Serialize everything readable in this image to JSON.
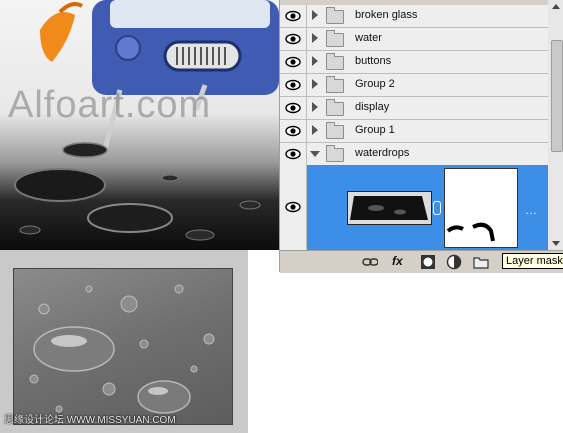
{
  "artwork": {
    "watermark_text": "Alfoart.com"
  },
  "layers_panel": {
    "layers": [
      {
        "name": "broken glass",
        "expanded": false
      },
      {
        "name": "water",
        "expanded": false
      },
      {
        "name": "buttons",
        "expanded": false
      },
      {
        "name": "Group 2",
        "expanded": false
      },
      {
        "name": "display",
        "expanded": false
      },
      {
        "name": "Group 1",
        "expanded": false
      },
      {
        "name": "waterdrops",
        "expanded": true
      }
    ],
    "mask_row_dots": "…",
    "tooltip": "Layer mask",
    "footer_icons": [
      "link-icon",
      "fx-icon",
      "mask-icon",
      "adjustment-icon",
      "folder-icon"
    ],
    "fx_label": "fx"
  },
  "preview": {
    "watermark_text": "思缘设计论坛 WWW.MISSYUAN.COM"
  },
  "colors": {
    "selection": "#3d8ee6",
    "panel_bg": "#d4d0c8",
    "row_bg": "#eeeeee"
  }
}
